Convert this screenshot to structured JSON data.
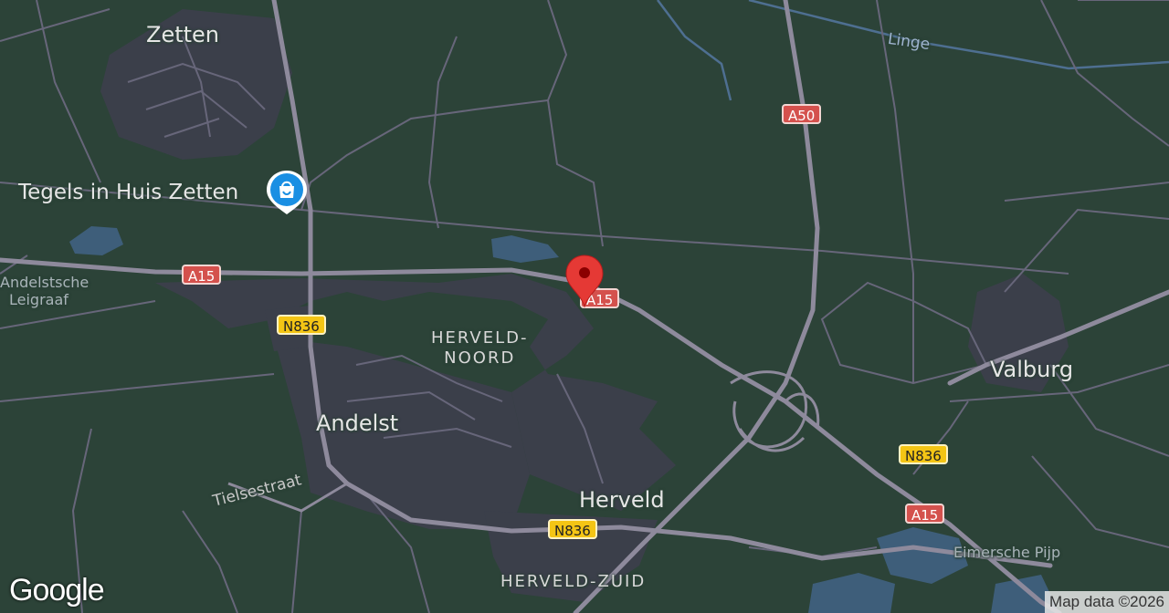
{
  "places": {
    "zetten": "Zetten",
    "andelst": "Andelst",
    "herveld": "Herveld",
    "valburg": "Valburg",
    "herveld_noord_1": "HERVELD-",
    "herveld_noord_2": "NOORD",
    "herveld_zuid": "HERVELD-ZUID",
    "andelstsche_1": "Andelstsche",
    "andelstsche_2": "Leigraaf",
    "eimersche": "Eimersche Pijp",
    "linge": "Linge",
    "tielsestraat": "Tielsestraat"
  },
  "poi": {
    "name": "Tegels in Huis Zetten",
    "icon": "shopping-bag-icon",
    "color": "#1a8fe3"
  },
  "road_shields": {
    "a15_west": "A15",
    "a15_pin": "A15",
    "a15_east": "A15",
    "a50": "A50",
    "n836_north": "N836",
    "n836_east": "N836",
    "n836_south": "N836"
  },
  "marker": {
    "icon": "map-pin-icon",
    "color": "#e53935"
  },
  "footer": {
    "logo": "Google",
    "attribution": "Map data ©2026"
  },
  "colors": {
    "land": "#2c4338",
    "urban": "#3b3f4a",
    "road": "#8e8a9c",
    "water": "#3e5e7a"
  }
}
